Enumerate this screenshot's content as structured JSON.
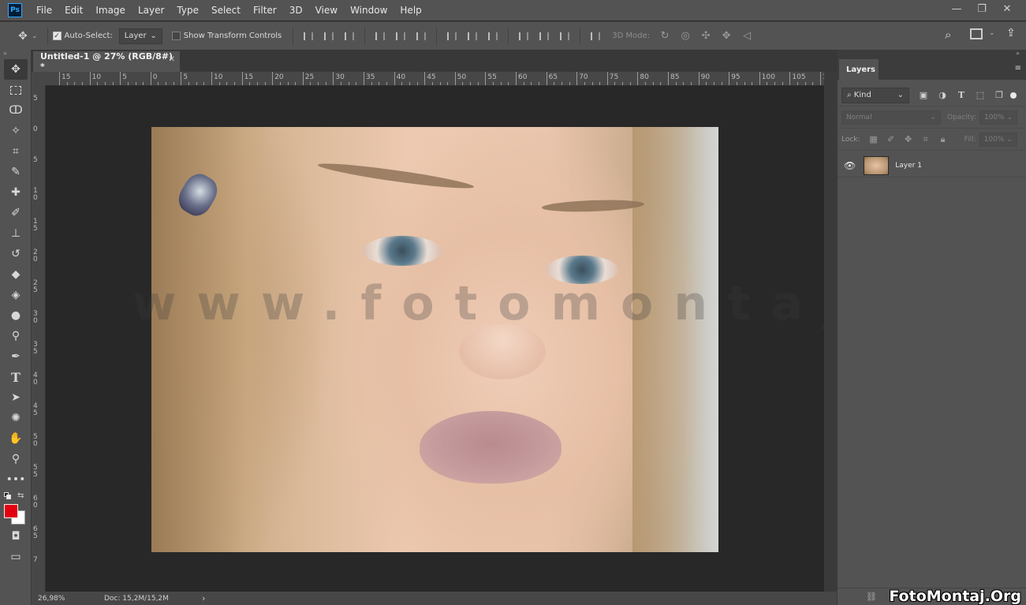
{
  "app": {
    "logo_text": "Ps",
    "menu": [
      "File",
      "Edit",
      "Image",
      "Layer",
      "Type",
      "Select",
      "Filter",
      "3D",
      "View",
      "Window",
      "Help"
    ],
    "window_controls": [
      "—",
      "❐",
      "✕"
    ]
  },
  "options": {
    "auto_select_label": "Auto-Select:",
    "auto_select_checked": true,
    "auto_select_target": "Layer",
    "transform_label": "Show Transform Controls",
    "transform_checked": false,
    "mode_3d_label": "3D Mode:"
  },
  "tools": [
    "move-icon",
    "marquee-icon",
    "lasso-icon",
    "magic-wand-icon",
    "crop-icon",
    "eyedropper-icon",
    "healing-brush-icon",
    "brush-icon",
    "clone-stamp-icon",
    "history-brush-icon",
    "eraser-icon",
    "paint-bucket-icon",
    "blur-icon",
    "dodge-icon",
    "pen-icon",
    "type-icon",
    "path-selection-icon",
    "custom-shape-icon",
    "hand-icon",
    "zoom-icon",
    "more-tools-icon"
  ],
  "colors": {
    "foreground": "#e3000f",
    "background": "#ffffff"
  },
  "document": {
    "tab_title": "Untitled-1 @ 27% (RGB/8#) *",
    "close_glyph": "✕"
  },
  "rulers": {
    "horizontal": [
      "15",
      "10",
      "5",
      "0",
      "5",
      "10",
      "15",
      "20",
      "25",
      "30",
      "35",
      "40",
      "45",
      "50",
      "55",
      "60",
      "65",
      "70",
      "75",
      "80",
      "85",
      "90",
      "95",
      "100",
      "105",
      "11"
    ],
    "vertical": [
      "5",
      "0",
      "5",
      "1\n0",
      "1\n5",
      "2\n0",
      "2\n5",
      "3\n0",
      "3\n5",
      "4\n0",
      "4\n5",
      "5\n0",
      "5\n5",
      "6\n0",
      "6\n5",
      "7"
    ]
  },
  "canvas": {
    "watermark": "www.fotomontaj.org"
  },
  "status": {
    "zoom": "26,98%",
    "doc": "Doc: 15,2M/15,2M",
    "arrow": "›"
  },
  "layers_panel": {
    "tab_label": "Layers",
    "filter_label": "Kind",
    "blend_mode": "Normal",
    "opacity_label": "Opacity:",
    "opacity_value": "100%",
    "lock_label": "Lock:",
    "fill_label": "Fill:",
    "fill_value": "100%",
    "layers": [
      {
        "name": "Layer 1",
        "visible": true
      }
    ]
  },
  "site_mark": "FotoMontaj.Org"
}
